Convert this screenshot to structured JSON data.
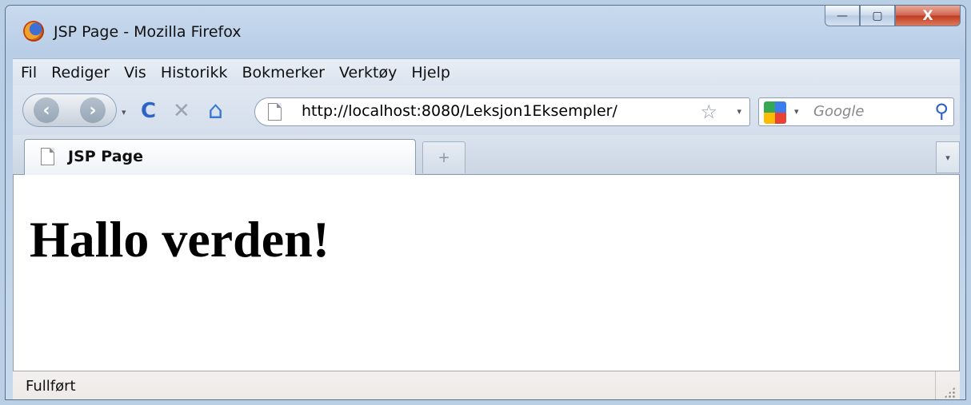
{
  "window": {
    "title": "JSP Page - Mozilla Firefox",
    "minimize_glyph": "—",
    "maximize_glyph": "▢",
    "close_glyph": "X"
  },
  "menu": {
    "items": [
      "Fil",
      "Rediger",
      "Vis",
      "Historikk",
      "Bokmerker",
      "Verktøy",
      "Hjelp"
    ]
  },
  "nav": {
    "back_glyph": "‹",
    "forward_glyph": "›",
    "reload_glyph": "C",
    "stop_glyph": "✕",
    "home_glyph": "⌂",
    "url": "http://localhost:8080/Leksjon1Eksempler/",
    "bookmark_star_glyph": "☆",
    "dropdown_glyph": "▾",
    "search_placeholder": "Google",
    "search_glyph": "⚲"
  },
  "tabs": {
    "active_label": "JSP Page",
    "new_tab_glyph": "+",
    "list_glyph": "▾"
  },
  "page": {
    "heading": "Hallo verden!"
  },
  "status": {
    "text": "Fullført"
  },
  "colors": {
    "title_bar": "#b9cfe6",
    "close_button": "#c9452a",
    "reload_icon": "#2e63c7",
    "home_icon": "#3b78d8",
    "stop_icon": "#9aa5b1"
  }
}
